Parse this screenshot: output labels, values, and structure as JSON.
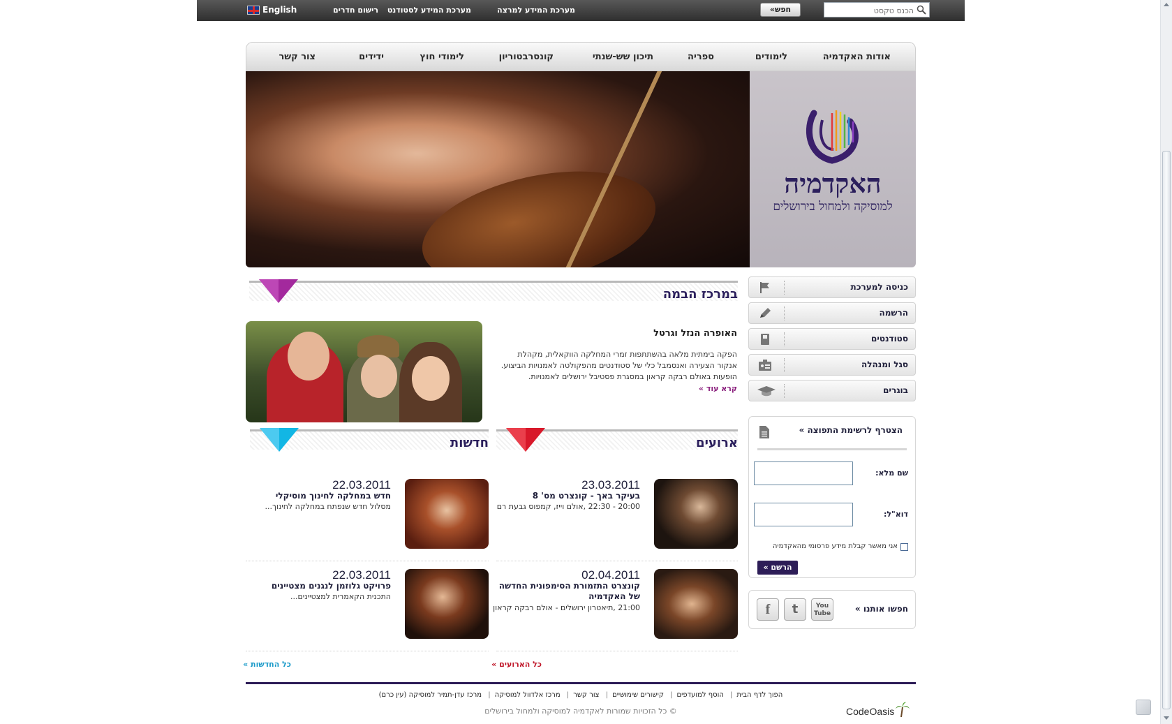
{
  "topbar": {
    "search_placeholder": "הכנס טקסט",
    "search_button": "חפש»",
    "links": [
      "מערכת המידע למרצה",
      "מערכת המידע לסטודנט",
      "רישום חדרים"
    ],
    "language": "English"
  },
  "nav": {
    "items": [
      "אודות האקדמיה",
      "לימודים",
      "ספריה",
      "תיכון שש-שנתי",
      "קונסרבטוריון",
      "לימודי חוץ",
      "ידידים",
      "צור קשר"
    ]
  },
  "hero": {
    "logo_title": "האקדמיה",
    "logo_subtitle": "למוסיקה ולמחול בירושלים"
  },
  "side_menu": {
    "items": [
      {
        "label": "כניסה למערכת",
        "icon": "flag-icon"
      },
      {
        "label": "הרשמה",
        "icon": "pencil-icon"
      },
      {
        "label": "סטודנטים",
        "icon": "book-icon"
      },
      {
        "label": "סגל ומנהלה",
        "icon": "id-card-icon"
      },
      {
        "label": "בוגרים",
        "icon": "graduation-cap-icon"
      }
    ]
  },
  "newsletter": {
    "title": "הצטרף לרשימת התפוצה »",
    "name_label": "שם מלא:",
    "email_label": "דוא\"ל:",
    "consent_label": "אני מאשר קבלת מידע פרסומי מהאקדמיה",
    "submit": "הרשם »"
  },
  "follow": {
    "title": "חפשו אותנו »",
    "networks": [
      "facebook",
      "twitter",
      "youtube"
    ]
  },
  "spotlight": {
    "heading": "במרכז הבמה",
    "title": "האופרה הנזל וגרטל",
    "description": "הפקה בימתית מלאה בהשתתפות זמרי המחלקה הווקאלית, מקהלת אנקור הצעירה ואנסמבל כלי של סטודנטים מהפקולטה לאמנויות הביצוע. הופעות באולם רבקה קראון במסגרת פסטיבל ירושלים לאמנויות.",
    "more": "קרא עוד »"
  },
  "events": {
    "heading": "ארועים",
    "items": [
      {
        "date": "23.03.2011",
        "title": "בעיקר באך - קונצרט מס' 8",
        "sub": "20:00 - 22:30 ,אולם וייז, קמפוס גבעת רם"
      },
      {
        "date": "02.04.2011",
        "title": "קונצרט התזמורת הסימפונית החדשה של האקדמיה",
        "sub": "21:00 ,תיאטרון ירושלים - אולם רבקה קראון"
      }
    ],
    "all_link": "כל הארועים »"
  },
  "news": {
    "heading": "חדשות",
    "items": [
      {
        "date": "22.03.2011",
        "title": "חדש במחלקה לחינוך מוסיקלי",
        "sub": "מסלול חדש שנפתח במחלקה לחינוך..."
      },
      {
        "date": "22.03.2011",
        "title": "פרויקט גלוזמן לנגנים מצטיינים",
        "sub": "התכנית הקאמרית למצטיינים..."
      }
    ],
    "all_link": "כל החדשות »"
  },
  "footer": {
    "links": [
      "הפוך לדף הבית",
      "הוסף למועדפים",
      "קישורים שימושיים",
      "צור קשר",
      "מרכז אלדוול למוסיקה",
      "מרכז עדן-תמיר למוסיקה (עין כרם)"
    ],
    "copyright": "© כל הזכויות שמורות לאקדמיה למוסיקה ולמחול בירושלים",
    "credit": "CodeOasis"
  },
  "colors": {
    "brand": "#2b1f5c",
    "accent_purple": "#a3299d",
    "accent_red": "#d8182a",
    "accent_cyan": "#12b6e4",
    "news_link": "#1a9ac9",
    "events_link": "#c0182a"
  }
}
